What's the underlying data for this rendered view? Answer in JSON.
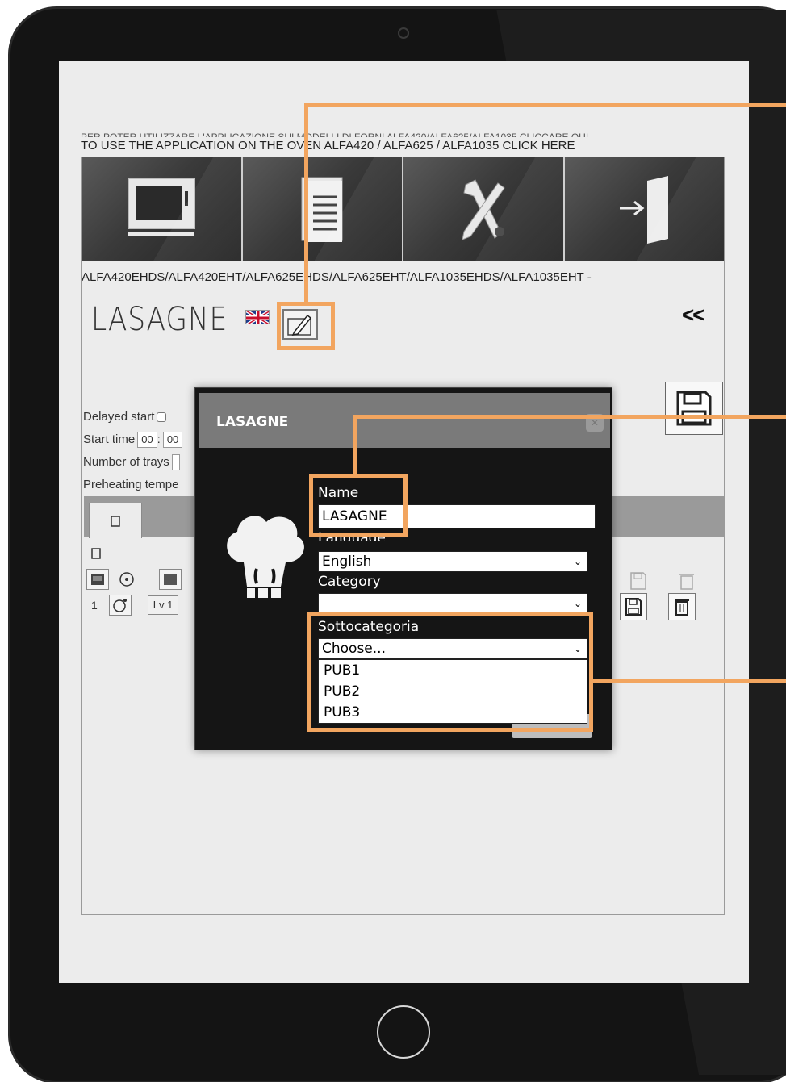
{
  "page": {
    "cut_text": "PER POTER UTILIZZARE L'APPLICAZIONE SUI MODELLI DI FORNI ALFA420/ALFA625/ALFA1035 CLICCARE QUI",
    "link_text": "TO USE THE APPLICATION ON THE OVEN ALFA420 / ALFA625 / ALFA1035 CLICK HERE",
    "models": "ALFA420EHDS/ALFA420EHT/ALFA625EHDS/ALFA625EHT/ALFA1035EHDS/ALFA1035EHT",
    "models_suffix": "-",
    "recipe_title": "LASAGNE",
    "collapse": "<<"
  },
  "tiles": [
    {
      "icon": "oven-icon"
    },
    {
      "icon": "recipe-book-icon"
    },
    {
      "icon": "tools-icon"
    },
    {
      "icon": "exit-door-icon"
    }
  ],
  "form": {
    "delayed_start": "Delayed start",
    "start_time": "Start time",
    "start_hours": "00",
    "start_minutes": "00",
    "number_of_trays": "Number of trays",
    "preheating": "Preheating tempe"
  },
  "grid": {
    "row_number": "1",
    "level": "Lv 1"
  },
  "modal": {
    "title": "LASAGNE",
    "name_label": "Name",
    "name_value": "LASAGNE",
    "language_label": "Language",
    "language_value": "English",
    "category_label": "Category",
    "category_value": "",
    "subcategory_label": "Sottocategoria",
    "subcategory_value": "Choose...",
    "subcategory_options": [
      "PUB1",
      "PUB2",
      "PUB3"
    ]
  },
  "colors": {
    "highlight": "#f2a55f",
    "modal_bg": "#151515",
    "modal_header": "#7a7a7a"
  }
}
